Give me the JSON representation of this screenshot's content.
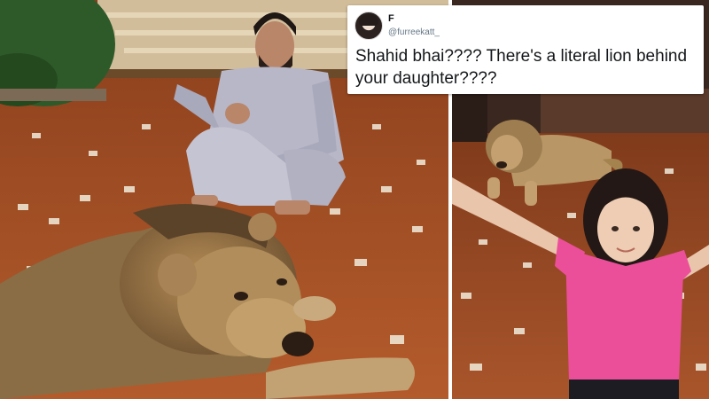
{
  "tweet": {
    "display_name": "F",
    "handle": "@furreekatt_",
    "text": "Shahid bhai???? There's a literal lion behind your daughter????"
  },
  "photos": {
    "left": {
      "scene": "man-crouching-beside-lion",
      "floor_color": "#a8542a"
    },
    "right": {
      "scene": "girl-arms-outstretched-lion-behind",
      "floor_color": "#9c4e26"
    }
  }
}
